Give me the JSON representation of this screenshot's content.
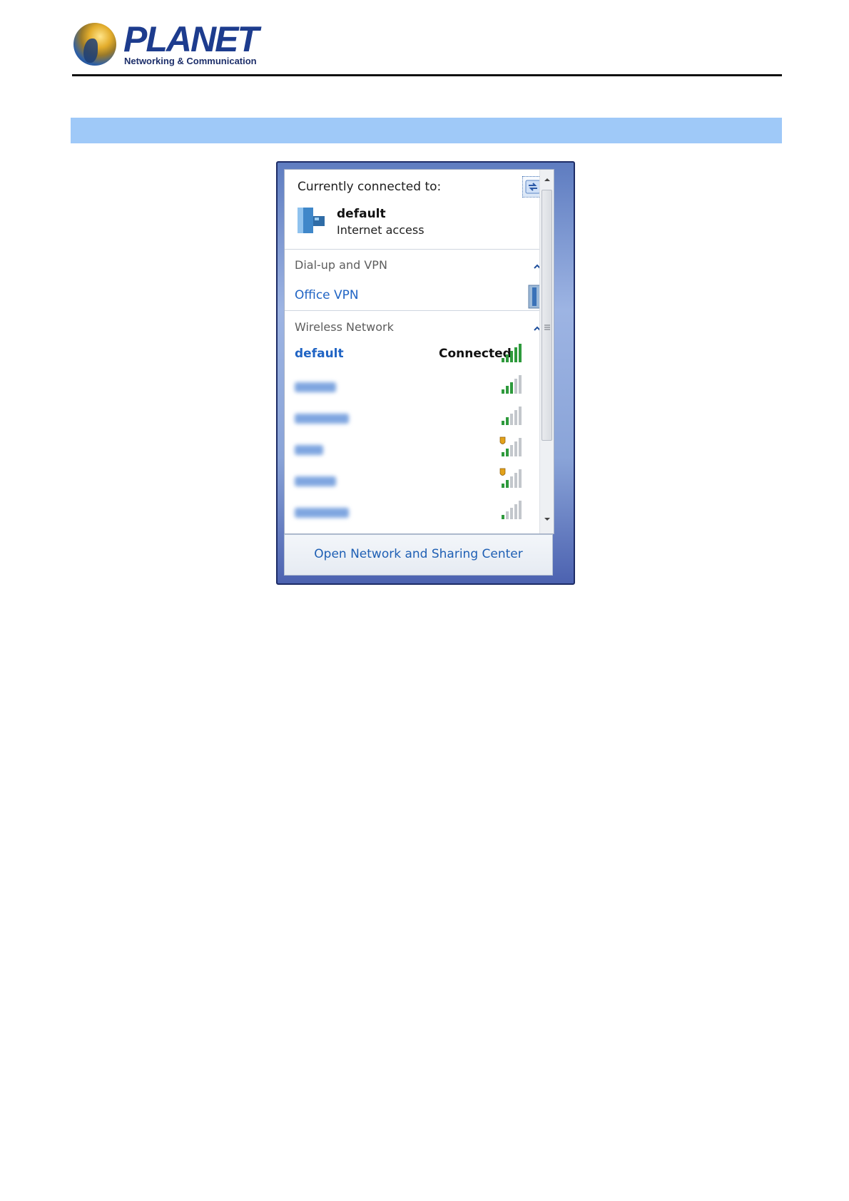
{
  "header": {
    "logo_word": "PLANET",
    "logo_tagline": "Networking & Communication"
  },
  "colors": {
    "band": "#9fc9f8",
    "link": "#2064c4",
    "signal_green": "#2e9a3c"
  },
  "flyout": {
    "current": {
      "title": "Currently connected to:",
      "network_name": "default",
      "access": "Internet access",
      "refresh_icon": "refresh-network-icon"
    },
    "dialup": {
      "title": "Dial-up and VPN",
      "items": [
        {
          "name": "Office VPN",
          "icon": "vpn-icon"
        }
      ]
    },
    "wireless": {
      "title": "Wireless Network",
      "networks": [
        {
          "name": "default",
          "status": "Connected",
          "signal_bars": 5,
          "secured_warning": false,
          "obscured": false
        },
        {
          "name": "",
          "status": "",
          "signal_bars": 3,
          "secured_warning": false,
          "obscured": true
        },
        {
          "name": "",
          "status": "",
          "signal_bars": 2,
          "secured_warning": false,
          "obscured": true
        },
        {
          "name": "",
          "status": "",
          "signal_bars": 2,
          "secured_warning": true,
          "obscured": true
        },
        {
          "name": "",
          "status": "",
          "signal_bars": 2,
          "secured_warning": true,
          "obscured": true
        },
        {
          "name": "",
          "status": "",
          "signal_bars": 1,
          "secured_warning": false,
          "obscured": true
        }
      ]
    },
    "footer_link": "Open Network and Sharing Center"
  }
}
